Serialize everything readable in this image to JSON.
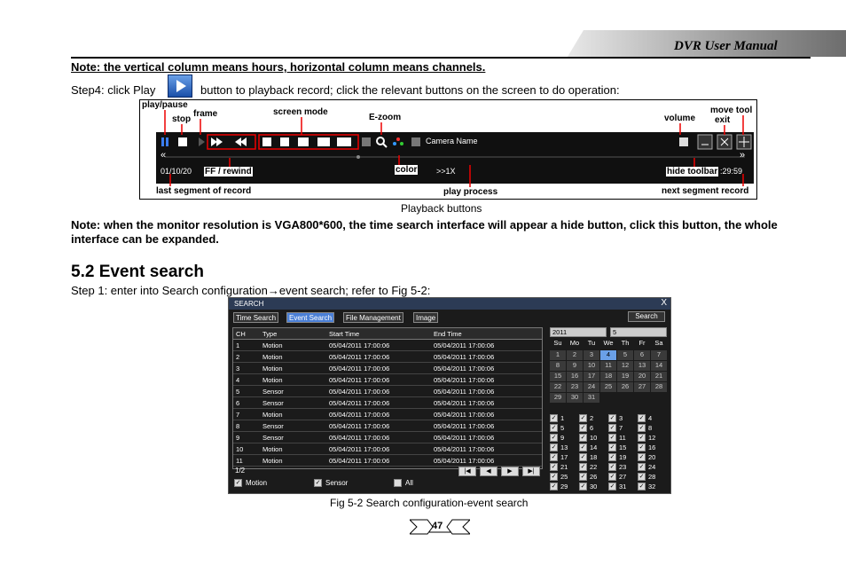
{
  "header": {
    "title": "DVR User Manual"
  },
  "note1": "Note: the vertical column means hours, horizontal column means channels.",
  "step4": {
    "before": "Step4: click Play",
    "after": "button to playback record; click the relevant buttons on the screen to do operation:"
  },
  "playback_fig": {
    "labels": {
      "play_pause": "play/pause",
      "stop": "stop",
      "frame": "frame",
      "screen_mode": "screen mode",
      "ezoom": "E-zoom",
      "volume": "volume",
      "move_tool": "move tool",
      "exit": "exit",
      "ff_rewind": "FF / rewind",
      "color": "color",
      "hide_toolbar": "hide toolbar",
      "last_segment": "last segment of record",
      "play_process": "play process",
      "next_segment": "next segment record"
    },
    "bar": {
      "camera_name": "Camera Name",
      "date_start": "01/10/20",
      "time_end": ":29:59",
      "speed": ">>1X"
    },
    "caption": "Playback buttons"
  },
  "note2": "Note: when the monitor resolution is VGA800*600, the time search interface will appear a hide button, click this button, the whole interface can be expanded.",
  "section": {
    "title": "5.2 Event search"
  },
  "step1": {
    "text": "Step 1: enter into Search configuration",
    "arrow": "→",
    "tail": "event search; refer to Fig 5-2:"
  },
  "search": {
    "title": "SEARCH",
    "close": "X",
    "tabs": [
      "Time Search",
      "Event Search",
      "File Management",
      "Image"
    ],
    "search_btn": "Search",
    "columns": [
      "CH",
      "Type",
      "Start Time",
      "End Time"
    ],
    "rows": [
      [
        "1",
        "Motion",
        "05/04/2011 17:00:06",
        "05/04/2011 17:00:06"
      ],
      [
        "2",
        "Motion",
        "05/04/2011 17:00:06",
        "05/04/2011 17:00:06"
      ],
      [
        "3",
        "Motion",
        "05/04/2011 17:00:06",
        "05/04/2011 17:00:06"
      ],
      [
        "4",
        "Motion",
        "05/04/2011 17:00:06",
        "05/04/2011 17:00:06"
      ],
      [
        "5",
        "Sensor",
        "05/04/2011 17:00:06",
        "05/04/2011 17:00:06"
      ],
      [
        "6",
        "Sensor",
        "05/04/2011 17:00:06",
        "05/04/2011 17:00:06"
      ],
      [
        "7",
        "Motion",
        "05/04/2011 17:00:06",
        "05/04/2011 17:00:06"
      ],
      [
        "8",
        "Sensor",
        "05/04/2011 17:00:06",
        "05/04/2011 17:00:06"
      ],
      [
        "9",
        "Sensor",
        "05/04/2011 17:00:06",
        "05/04/2011 17:00:06"
      ],
      [
        "10",
        "Motion",
        "05/04/2011 17:00:06",
        "05/04/2011 17:00:06"
      ],
      [
        "11",
        "Motion",
        "05/04/2011 17:00:06",
        "05/04/2011 17:00:06"
      ]
    ],
    "page": "1/2",
    "filters": [
      "Motion",
      "Sensor",
      "All"
    ],
    "calendar": {
      "year": "2011",
      "month": "5",
      "days_header": [
        "Su",
        "Mo",
        "Tu",
        "We",
        "Th",
        "Fr",
        "Sa"
      ],
      "days": [
        "1",
        "2",
        "3",
        "4",
        "5",
        "6",
        "7",
        "8",
        "9",
        "10",
        "11",
        "12",
        "13",
        "14",
        "15",
        "16",
        "17",
        "18",
        "19",
        "20",
        "21",
        "22",
        "23",
        "24",
        "25",
        "26",
        "27",
        "28",
        "29",
        "30",
        "31"
      ],
      "selected": "4"
    },
    "channels": [
      "1",
      "2",
      "3",
      "4",
      "5",
      "6",
      "7",
      "8",
      "9",
      "10",
      "11",
      "12",
      "13",
      "14",
      "15",
      "16",
      "17",
      "18",
      "19",
      "20",
      "21",
      "22",
      "23",
      "24",
      "25",
      "26",
      "27",
      "28",
      "29",
      "30",
      "31",
      "32"
    ]
  },
  "fig_caption": "Fig 5-2 Search configuration-event search",
  "page_number": "47"
}
